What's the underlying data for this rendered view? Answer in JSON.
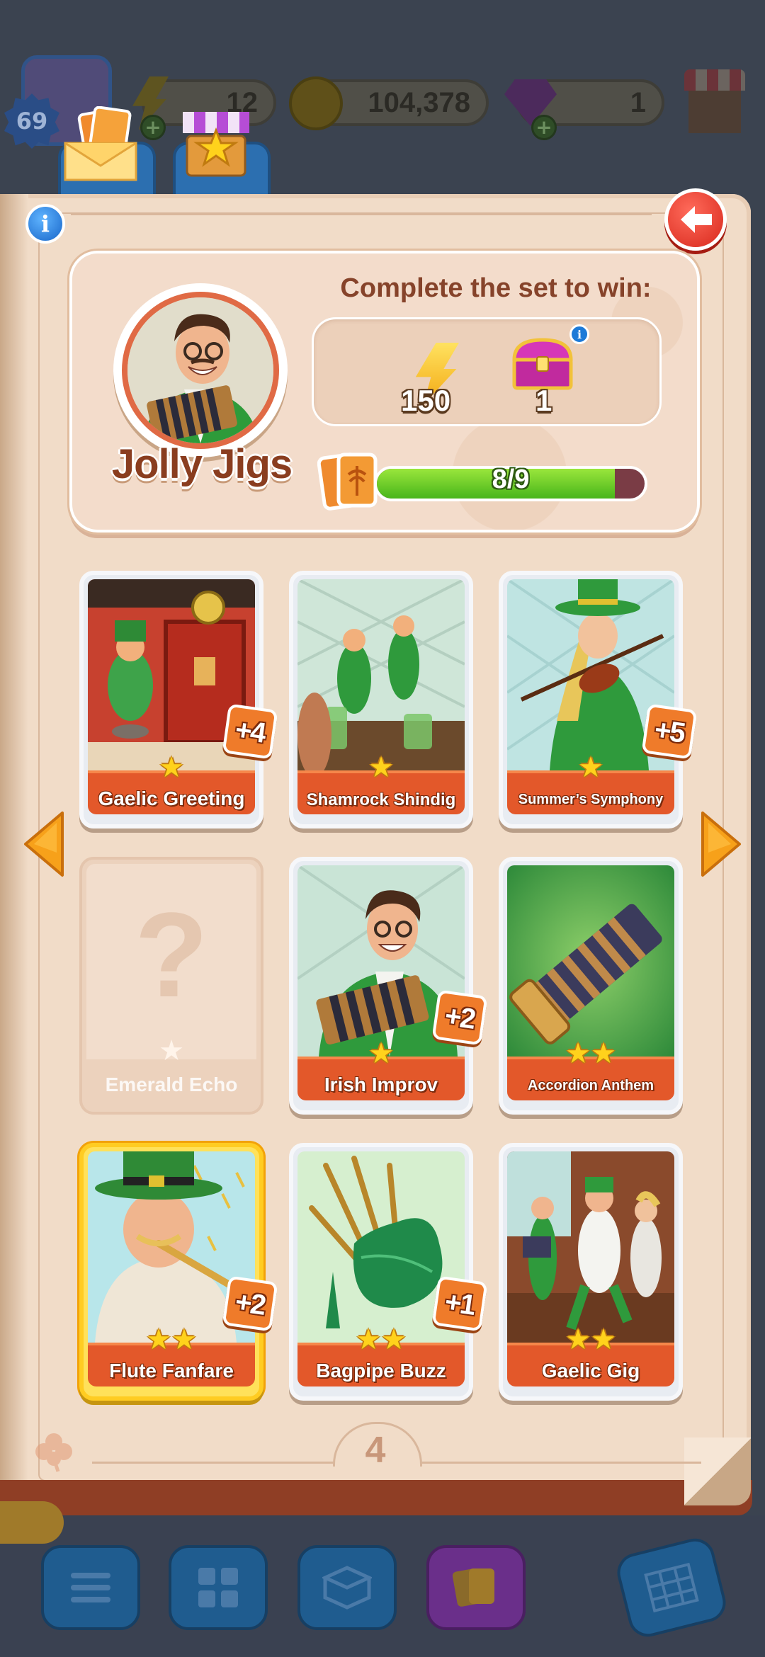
{
  "hud": {
    "level": "69",
    "energy": "12",
    "coins": "104,378",
    "gems": "1"
  },
  "icons": {
    "avatar": "player-avatar",
    "energy": "lightning-bolt",
    "coins": "palm-coin",
    "gems": "purple-gem",
    "shop": "market-stall",
    "cards_tab": "card-envelope",
    "star_shop_tab": "star-shop",
    "info": "info-circle",
    "close": "back-arrow",
    "chest": "treasure-chest"
  },
  "set": {
    "title": "Jolly Jigs",
    "reward_heading": "Complete the set to win:",
    "rewards": {
      "energy_amount": "150",
      "chest_amount": "1"
    },
    "progress": {
      "label": "8/9",
      "collected": 8,
      "total": 9
    }
  },
  "cards": [
    {
      "name": "Gaelic Greeting",
      "stars": "★",
      "duplicates": "+4",
      "state": "owned"
    },
    {
      "name": "Shamrock Shindig",
      "stars": "★",
      "duplicates": "",
      "state": "owned"
    },
    {
      "name": "Summer’s Symphony",
      "stars": "★",
      "duplicates": "+5",
      "state": "owned"
    },
    {
      "name": "Emerald Echo",
      "stars": "★",
      "duplicates": "",
      "state": "missing",
      "placeholder": "?"
    },
    {
      "name": "Irish Improv",
      "stars": "★",
      "duplicates": "+2",
      "state": "owned"
    },
    {
      "name": "Accordion Anthem",
      "stars": "★★",
      "duplicates": "",
      "state": "owned"
    },
    {
      "name": "Flute Fanfare",
      "stars": "★★",
      "duplicates": "+2",
      "state": "gold"
    },
    {
      "name": "Bagpipe Buzz",
      "stars": "★★",
      "duplicates": "+1",
      "state": "owned"
    },
    {
      "name": "Gaelic Gig",
      "stars": "★★",
      "duplicates": "",
      "state": "owned"
    }
  ],
  "page_number": "4",
  "colors": {
    "accent_orange": "#e3582a",
    "progress_green": "#48b51a",
    "close_red": "#d8281c",
    "info_blue": "#1866c9",
    "gold_card": "#ffcc22"
  }
}
